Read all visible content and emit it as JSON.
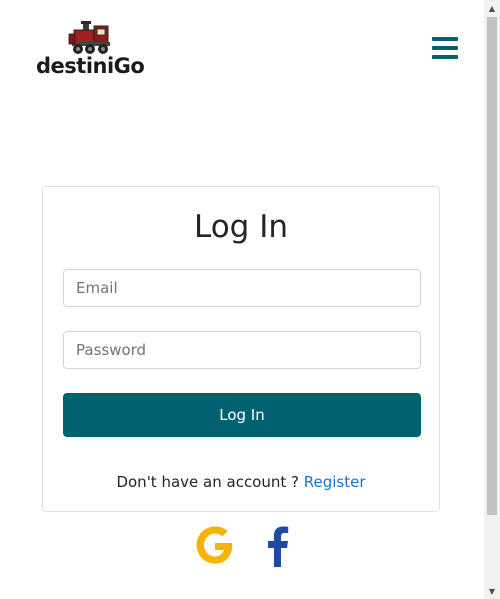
{
  "header": {
    "logo_text": "destiniGo",
    "menu_icon": "hamburger-menu-icon",
    "accent_color": "#006270"
  },
  "login": {
    "title": "Log In",
    "email_placeholder": "Email",
    "password_placeholder": "Password",
    "submit_label": "Log In",
    "register_prompt": "Don't have an account ? ",
    "register_link": "Register"
  },
  "social": {
    "google_icon": "google-icon",
    "facebook_icon": "facebook-icon"
  },
  "colors": {
    "primary": "#006270",
    "link": "#1a73c8",
    "google": "#f4b400",
    "facebook": "#1e4ba1"
  }
}
